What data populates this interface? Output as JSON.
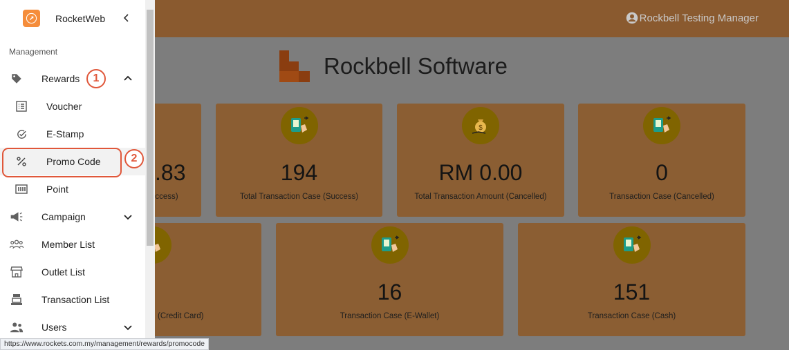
{
  "app": {
    "name": "RocketWeb"
  },
  "header": {
    "user_name": "Rockbell Testing Manager"
  },
  "brand": {
    "title": "Rockbell Software"
  },
  "sidebar": {
    "section_label": "Management",
    "items": [
      {
        "label": "Rewards",
        "icon": "tag-icon"
      },
      {
        "label": "Voucher",
        "icon": "list-icon"
      },
      {
        "label": "E-Stamp",
        "icon": "check-circle-icon"
      },
      {
        "label": "Promo Code",
        "icon": "percent-icon"
      },
      {
        "label": "Point",
        "icon": "points-icon"
      },
      {
        "label": "Campaign",
        "icon": "megaphone-icon"
      },
      {
        "label": "Member List",
        "icon": "members-icon"
      },
      {
        "label": "Outlet List",
        "icon": "store-icon"
      },
      {
        "label": "Transaction List",
        "icon": "register-icon"
      },
      {
        "label": "Users",
        "icon": "users-icon"
      }
    ]
  },
  "annotations": {
    "step1": "1",
    "step2": "2"
  },
  "cards": [
    {
      "value": ".83",
      "label": "uccess)"
    },
    {
      "value": "194",
      "label": "Total Transaction Case (Success)"
    },
    {
      "value": "RM 0.00",
      "label": "Total Transaction Amount (Cancelled)"
    },
    {
      "value": "0",
      "label": "Transaction Case (Cancelled)"
    },
    {
      "value": "",
      "label": "(Credit Card)"
    },
    {
      "value": "16",
      "label": "Transaction Case (E-Wallet)"
    },
    {
      "value": "151",
      "label": "Transaction Case (Cash)"
    }
  ],
  "status_bar": {
    "url": "https://www.rockets.com.my/management/rewards/promocode"
  },
  "colors": {
    "accent": "#e0573a",
    "topbar": "#8a5a2f",
    "card": "#8b5e33",
    "logo": "#f58d3b"
  }
}
